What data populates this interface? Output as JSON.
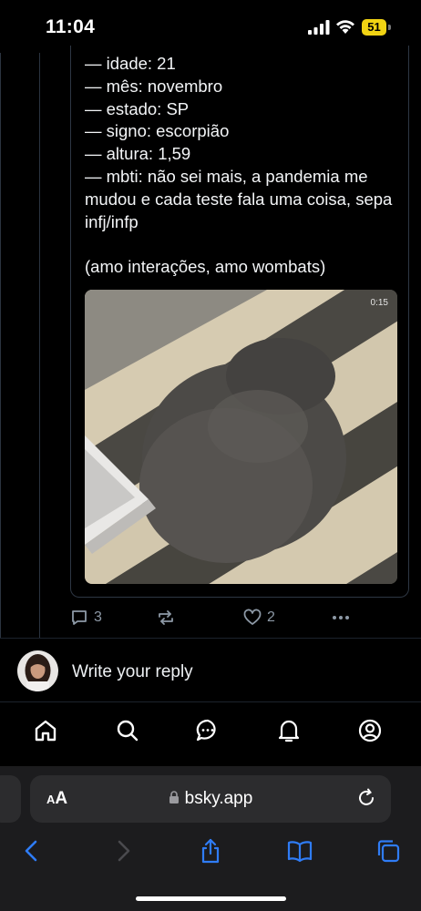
{
  "status_bar": {
    "time": "11:04",
    "battery_level": "51",
    "battery_color": "#f1d313"
  },
  "post": {
    "bio_lines": [
      "— idade: 21",
      "— mês: novembro",
      "— estado: SP",
      "— signo: escorpião",
      "— altura: 1,59",
      "— mbti: não sei mais, a pandemia me mudou e cada teste fala uma coisa, sepa infj/infp"
    ],
    "closing": "(amo interações, amo wombats)",
    "media": {
      "timestamp": "0:15",
      "description_icon": "wombat-video-thumbnail"
    }
  },
  "engagement": {
    "reply_count": "3",
    "like_count": "2",
    "icons": [
      "comment-icon",
      "repost-icon",
      "heart-icon",
      "more-icon"
    ]
  },
  "reply": {
    "prompt": "Write your reply"
  },
  "bottom_nav": {
    "items": [
      "home-icon",
      "search-icon",
      "chat-icon",
      "notifications-icon",
      "profile-icon"
    ]
  },
  "browser": {
    "aa_label_big": "A",
    "aa_label_small": "A",
    "url": "bsky.app"
  },
  "colors": {
    "background": "#000000",
    "muted": "#8d99a6",
    "border": "#2e3744",
    "link_blue": "#2f7cf6"
  }
}
